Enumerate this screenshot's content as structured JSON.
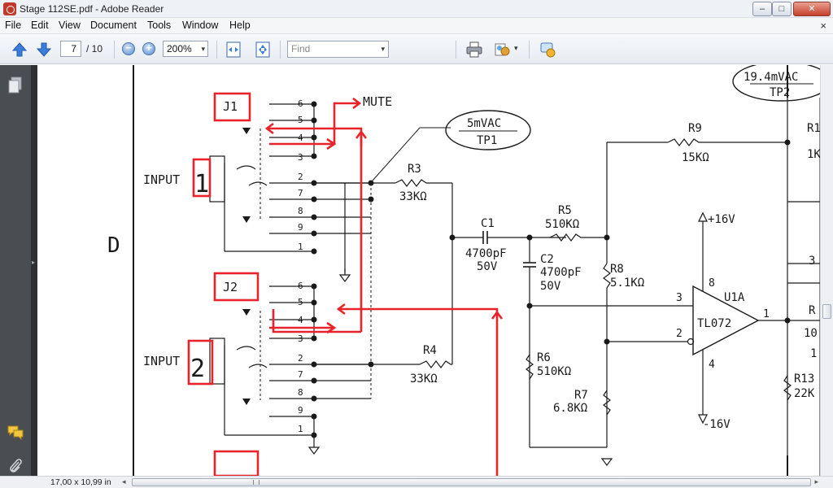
{
  "window": {
    "title": "Stage 112SE.pdf - Adobe Reader",
    "minimize_glyph": "–",
    "maximize_glyph": "□",
    "close_glyph": "✕"
  },
  "menu": {
    "items": [
      "File",
      "Edit",
      "View",
      "Document",
      "Tools",
      "Window",
      "Help"
    ],
    "close_glyph": "×"
  },
  "toolbar": {
    "page_current": "7",
    "page_total": "/ 10",
    "zoom_out_glyph": "−",
    "zoom_in_glyph": "+",
    "zoom": "200%",
    "dropdown_glyph": "▾",
    "find_placeholder": "Find"
  },
  "status": {
    "page_size": "17,00 x 10,99 in"
  },
  "schematic": {
    "section_letter": "D",
    "j1_label": "J1",
    "j2_label": "J2",
    "input1_label": "INPUT",
    "input1_number": "1",
    "input2_label": "INPUT",
    "input2_number": "2",
    "mute_label": "MUTE",
    "pins_jack": [
      "6",
      "5",
      "4",
      "3",
      "2",
      "7",
      "8",
      "9",
      "1"
    ],
    "tp1_value": "5mVAC",
    "tp1_label": "TP1",
    "tp2_value": "19.4mVAC",
    "tp2_label": "TP2",
    "r3_name": "R3",
    "r3_value": "33KΩ",
    "r4_name": "R4",
    "r4_value": "33KΩ",
    "r5_name": "R5",
    "r5_value": "510KΩ",
    "r6_name": "R6",
    "r6_value": "510KΩ",
    "r7_name": "R7",
    "r7_value": "6.8KΩ",
    "r8_name": "R8",
    "r8_value": "5.1KΩ",
    "r9_name": "R9",
    "r9_value": "15KΩ",
    "r13_name": "R13",
    "r13_value": "22K",
    "c1_name": "C1",
    "c1_value": "4700pF",
    "c1_voltage": "50V",
    "c2_name": "C2",
    "c2_value": "4700pF",
    "c2_voltage": "50V",
    "u1a_name": "U1A",
    "u1a_part": "TL072",
    "u1a_pin8": "8",
    "u1a_pin3": "3",
    "u1a_pin2": "2",
    "u1a_pin4": "4",
    "u1a_pin1": "1",
    "vplus": "+16V",
    "vminus": "-16V",
    "edge_r1": "R1",
    "edge_1k": "1K",
    "edge_3": "3",
    "edge_r": "R",
    "edge_10": "10",
    "edge_1": "1"
  },
  "colors": {
    "annotation_red": "#e8242a",
    "schematic_ink": "#1a1a1a"
  },
  "icons": {
    "prev_page": "arrow-up-icon",
    "next_page": "arrow-down-icon",
    "zoom_out": "zoom-out-icon",
    "zoom_in": "zoom-in-icon",
    "fit_width": "fit-width-icon",
    "fit_page": "fit-page-icon",
    "print": "printer-icon",
    "share": "share-icon",
    "collaborate": "collaborate-icon",
    "pages_panel": "pages-icon",
    "comments": "comments-icon",
    "attachments": "paperclip-icon"
  }
}
